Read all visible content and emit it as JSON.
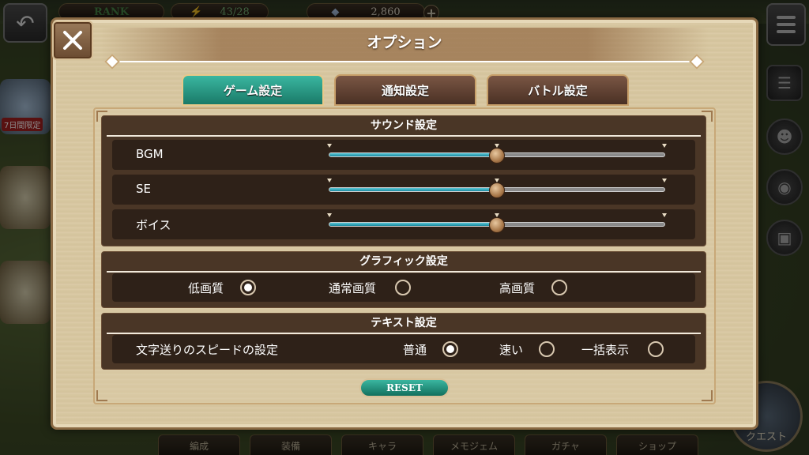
{
  "hud": {
    "rank_label": "RANK",
    "stamina": "43/28",
    "currency": "2,860",
    "plus": "+"
  },
  "side_banner": {
    "limited_label": "7日間限定"
  },
  "bottom_nav": [
    "編成",
    "装備",
    "キャラ",
    "メモジェム",
    "ガチャ",
    "ショップ"
  ],
  "quest_button": "クエスト",
  "options": {
    "title": "オプション",
    "close_icon": "close-icon",
    "tabs": [
      {
        "label": "ゲーム設定",
        "active": true
      },
      {
        "label": "通知設定",
        "active": false
      },
      {
        "label": "バトル設定",
        "active": false
      }
    ],
    "sound": {
      "heading": "サウンド設定",
      "sliders": [
        {
          "label": "BGM",
          "level": 0.5
        },
        {
          "label": "SE",
          "level": 0.5
        },
        {
          "label": "ボイス",
          "level": 0.5
        }
      ]
    },
    "graphics": {
      "heading": "グラフィック設定",
      "options": [
        {
          "label": "低画質",
          "selected": true
        },
        {
          "label": "通常画質",
          "selected": false
        },
        {
          "label": "高画質",
          "selected": false
        }
      ]
    },
    "text": {
      "heading": "テキスト設定",
      "row_label": "文字送りのスピードの設定",
      "options": [
        {
          "label": "普通",
          "selected": true
        },
        {
          "label": "速い",
          "selected": false
        },
        {
          "label": "一括表示",
          "selected": false
        }
      ]
    },
    "reset_label": "RESET"
  },
  "colors": {
    "accent_teal": "#1a8a76",
    "panel_parchment": "#d8c8a2",
    "section_brown": "#4a3626"
  }
}
